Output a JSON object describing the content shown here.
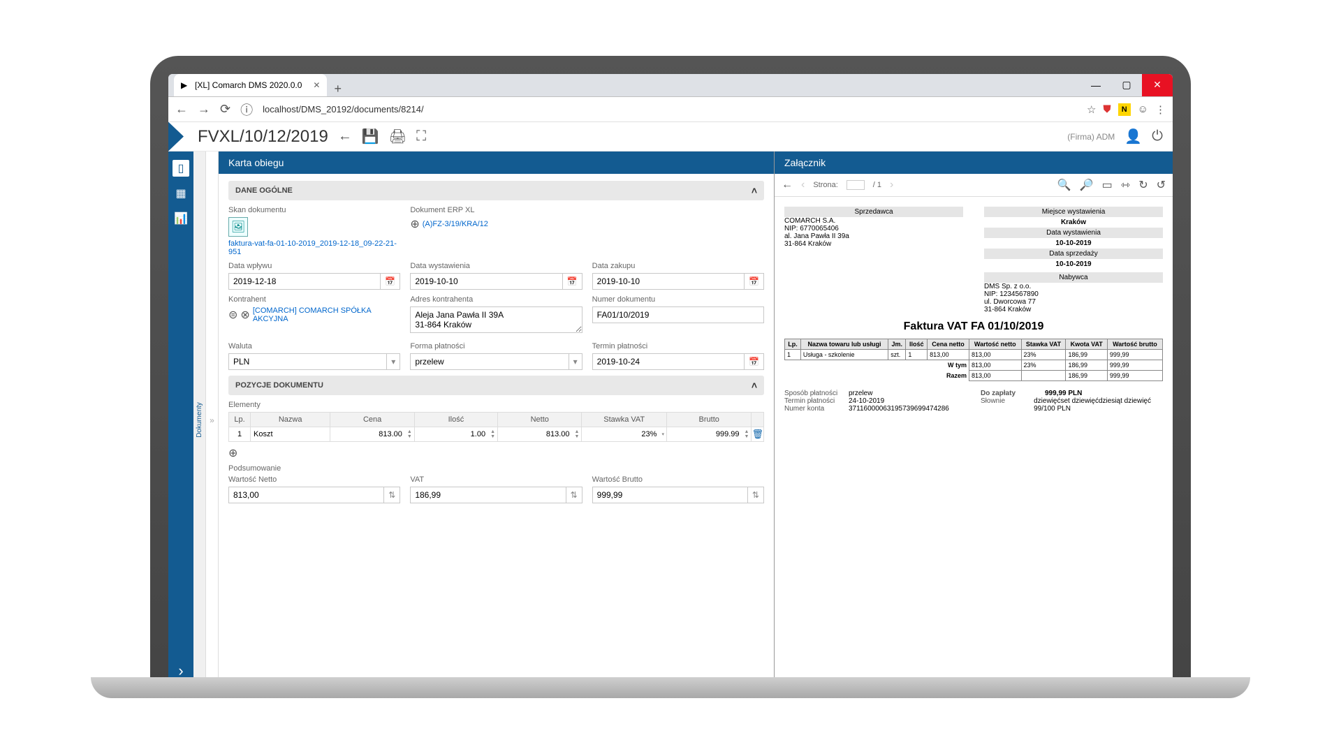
{
  "browser": {
    "tab_title": "[XL] Comarch DMS 2020.0.0",
    "url": "localhost/DMS_20192/documents/8214/"
  },
  "header": {
    "doc_title": "FVXL/10/12/2019",
    "user_context": "(Firma) ADM"
  },
  "sidebar": {
    "vlabel": "Dokumenty"
  },
  "left_panel": {
    "title": "Karta obiegu"
  },
  "sections": {
    "dane_ogolne": {
      "title": "DANE OGÓLNE",
      "skan_label": "Skan dokumentu",
      "skan_file": "faktura-vat-fa-01-10-2019_2019-12-18_09-22-21-951",
      "erp_label": "Dokument ERP XL",
      "erp_doc": "(A)FZ-3/19/KRA/12",
      "data_wplywu_lbl": "Data wpływu",
      "data_wplywu": "2019-12-18",
      "data_wyst_lbl": "Data wystawienia",
      "data_wyst": "2019-10-10",
      "data_zak_lbl": "Data zakupu",
      "data_zak": "2019-10-10",
      "kontrahent_lbl": "Kontrahent",
      "kontrahent": "[COMARCH] COMARCH SPÓŁKA AKCYJNA",
      "adres_lbl": "Adres kontrahenta",
      "adres": "Aleja Jana Pawła II 39A\n31-864 Kraków",
      "numer_lbl": "Numer dokumentu",
      "numer": "FA01/10/2019",
      "waluta_lbl": "Waluta",
      "waluta": "PLN",
      "forma_lbl": "Forma płatności",
      "forma": "przelew",
      "termin_lbl": "Termin płatności",
      "termin": "2019-10-24"
    },
    "pozycje": {
      "title": "POZYCJE DOKUMENTU",
      "elementy_lbl": "Elementy",
      "cols": {
        "lp": "Lp.",
        "nazwa": "Nazwa",
        "cena": "Cena",
        "ilosc": "Ilość",
        "netto": "Netto",
        "stawka": "Stawka VAT",
        "brutto": "Brutto"
      },
      "row": {
        "lp": "1",
        "nazwa": "Koszt",
        "cena": "813.00",
        "ilosc": "1.00",
        "netto": "813.00",
        "stawka": "23%",
        "brutto": "999.99"
      },
      "pods_lbl": "Podsumowanie",
      "wn_lbl": "Wartość Netto",
      "wn": "813,00",
      "vat_lbl": "VAT",
      "vat": "186,99",
      "wb_lbl": "Wartość Brutto",
      "wb": "999,99"
    }
  },
  "right_panel": {
    "title": "Załącznik",
    "page_label": "Strona:",
    "page_total": "/ 1"
  },
  "invoice": {
    "miejsce_lbl": "Miejsce wystawienia",
    "miejsce": "Kraków",
    "datawyst_lbl": "Data wystawienia",
    "datawyst": "10-10-2019",
    "dataspr_lbl": "Data sprzedaży",
    "dataspr": "10-10-2019",
    "sprzedawca_lbl": "Sprzedawca",
    "s_name": "COMARCH S.A.",
    "s_nip": "NIP: 6770065406",
    "s_addr1": "al. Jana Pawła II 39a",
    "s_addr2": "31-864 Kraków",
    "nabywca_lbl": "Nabywca",
    "n_name": "DMS Sp. z o.o.",
    "n_nip": "NIP: 1234567890",
    "n_addr1": "ul. Dworcowa 77",
    "n_addr2": "31-864 Kraków",
    "title": "Faktura VAT FA 01/10/2019",
    "th": {
      "lp": "Lp.",
      "nazwa": "Nazwa towaru lub usługi",
      "jm": "Jm.",
      "ilosc": "Ilość",
      "cnetto": "Cena netto",
      "wnetto": "Wartość netto",
      "stawka": "Stawka VAT",
      "kvat": "Kwota VAT",
      "wbrutto": "Wartość brutto"
    },
    "r1": {
      "lp": "1",
      "nazwa": "Usługa - szkolenie",
      "jm": "szt.",
      "ilosc": "1",
      "cnetto": "813,00",
      "wnetto": "813,00",
      "stawka": "23%",
      "kvat": "186,99",
      "wbrutto": "999,99"
    },
    "wtym": "W tym",
    "razem": "Razem",
    "sposob_lbl": "Sposób płatności",
    "sposob": "przelew",
    "termin_lbl": "Termin płatności",
    "termin": "24-10-2019",
    "konto_lbl": "Numer konta",
    "konto": "37116000063195739699474286",
    "dozaplaty_lbl": "Do zapłaty",
    "dozaplaty": "999,99 PLN",
    "slownie_lbl": "Słownie",
    "slownie": "dziewięćset dziewięćdziesiąt dziewięć 99/100 PLN"
  }
}
